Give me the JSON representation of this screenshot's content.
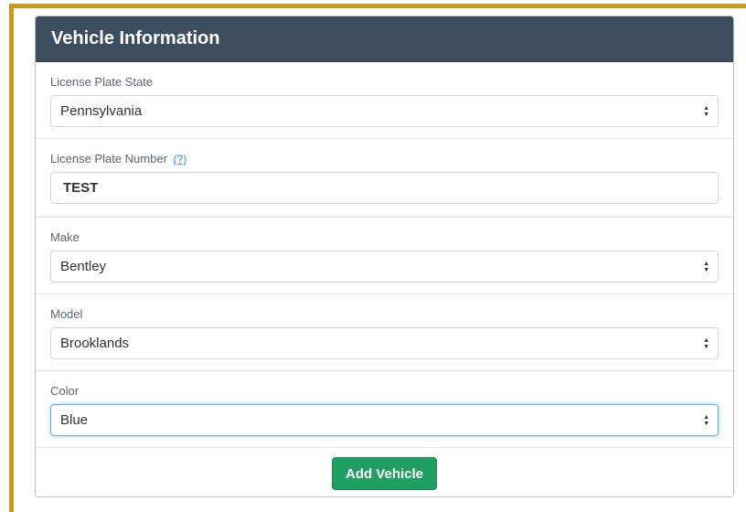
{
  "panel": {
    "title": "Vehicle Information"
  },
  "fields": {
    "state": {
      "label": "License Plate State",
      "value": "Pennsylvania"
    },
    "plate_number": {
      "label": "License Plate Number",
      "help_link": "(?)",
      "value": "TEST"
    },
    "make": {
      "label": "Make",
      "value": "Bentley"
    },
    "model": {
      "label": "Model",
      "value": "Brooklands"
    },
    "color": {
      "label": "Color",
      "value": "Blue"
    }
  },
  "actions": {
    "add_vehicle_label": "Add Vehicle"
  },
  "icons": {
    "select_arrows": "up-down-chevron-icon"
  },
  "colors": {
    "header_bg": "#3c4d5f",
    "button_green": "#1fa062",
    "frame_gold": "#c99a1e",
    "focus_blue": "#66afe9",
    "link_blue": "#2f8ad1"
  }
}
